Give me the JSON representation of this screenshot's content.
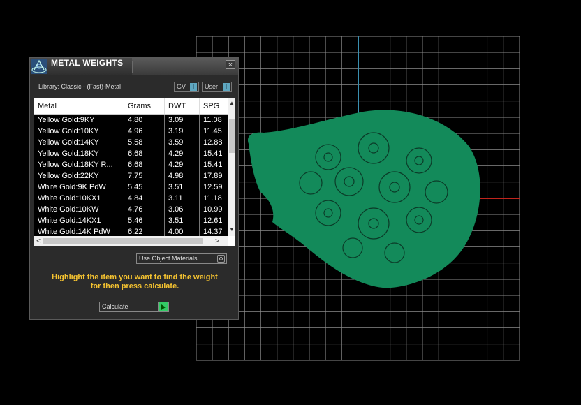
{
  "panel": {
    "title": "METAL WEIGHTS",
    "close_label": "×",
    "library_label": "Library: Classic - (Fast)-Metal",
    "toggle_gv_label": "GV",
    "toggle_user_label": "User",
    "toggle_switch_glyph": "I",
    "use_object_materials_label": "Use Object Materials",
    "hint_line1": "Highlight the item you want to find the weight",
    "hint_line2": "for then press calculate.",
    "calculate_label": "Calculate"
  },
  "table": {
    "columns": [
      "Metal",
      "Grams",
      "DWT",
      "SPG"
    ],
    "rows": [
      [
        "Yellow Gold:9KY",
        "4.80",
        "3.09",
        "11.08"
      ],
      [
        "Yellow Gold:10KY",
        "4.96",
        "3.19",
        "11.45"
      ],
      [
        "Yellow Gold:14KY",
        "5.58",
        "3.59",
        "12.88"
      ],
      [
        "Yellow Gold:18KY",
        "6.68",
        "4.29",
        "15.41"
      ],
      [
        "Yellow Gold:18KY R...",
        "6.68",
        "4.29",
        "15.41"
      ],
      [
        "Yellow Gold:22KY",
        "7.75",
        "4.98",
        "17.89"
      ],
      [
        "White Gold:9K PdW",
        "5.45",
        "3.51",
        "12.59"
      ],
      [
        "White Gold:10KX1",
        "4.84",
        "3.11",
        "11.18"
      ],
      [
        "White Gold:10KW",
        "4.76",
        "3.06",
        "10.99"
      ],
      [
        "White Gold:14KX1",
        "5.46",
        "3.51",
        "12.61"
      ],
      [
        "White Gold:14K PdW",
        "6.22",
        "4.00",
        "14.37"
      ]
    ],
    "scroll_up": "▲",
    "scroll_down": "▼",
    "scroll_left": "<",
    "scroll_right": ">"
  },
  "colors": {
    "shape_fill": "#138a5a",
    "grid": "#8a8a8a",
    "axis_y": "#3a8fb0",
    "axis_x": "#c0241c",
    "hint": "#f4c230"
  },
  "icons": [
    "app-logo-icon",
    "close-icon",
    "radio-icon",
    "play-icon"
  ]
}
